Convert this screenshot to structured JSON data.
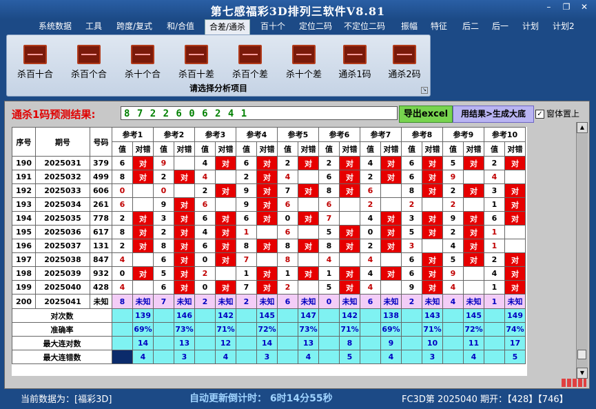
{
  "title": "第七感福彩3D排列三软件V8.81",
  "window_buttons": [
    "–",
    "❐",
    "✕"
  ],
  "menu": [
    "系统数据",
    "工具",
    "跨度/复式",
    "和/合值",
    "合差/通杀",
    "百十个",
    "定位二码",
    "不定位二码",
    "振幅",
    "特征",
    "后二",
    "后一",
    "计划",
    "计划2"
  ],
  "menu_active_index": 4,
  "ribbon": {
    "buttons": [
      "杀百十合",
      "杀百个合",
      "杀十个合",
      "杀百十差",
      "杀百个差",
      "杀十个差",
      "通杀1码",
      "通杀2码"
    ],
    "caption": "请选择分析项目"
  },
  "prediction": {
    "label": "通杀1码预测结果:",
    "value": "8 7 2 2 6 0 6 2 4 1",
    "export_button": "导出excel",
    "generate_button": "用结果>生成大底",
    "checkbox_label": "窗体置上",
    "checkbox_checked": true
  },
  "table": {
    "headers": {
      "seq": "序号",
      "period": "期号",
      "number": "号码",
      "value": "值",
      "result": "对错"
    },
    "refs": [
      "参考1",
      "参考2",
      "参考3",
      "参考4",
      "参考5",
      "参考6",
      "参考7",
      "参考8",
      "参考9",
      "参考10"
    ],
    "hit_text": "对",
    "rows": [
      {
        "seq": "190",
        "period": "2025031",
        "number": "379",
        "vals": [
          "6",
          "9",
          "4",
          "6",
          "2",
          "2",
          "4",
          "6",
          "5",
          "2"
        ],
        "hits": [
          1,
          0,
          1,
          1,
          1,
          1,
          1,
          1,
          1,
          1
        ],
        "red": [
          0,
          1,
          0,
          0,
          0,
          0,
          0,
          0,
          0,
          0
        ]
      },
      {
        "seq": "191",
        "period": "2025032",
        "number": "499",
        "vals": [
          "8",
          "2",
          "4",
          "2",
          "4",
          "6",
          "2",
          "6",
          "9",
          "4"
        ],
        "hits": [
          1,
          1,
          0,
          1,
          0,
          1,
          1,
          1,
          0,
          0
        ],
        "red": [
          0,
          0,
          1,
          0,
          1,
          0,
          0,
          0,
          1,
          1
        ]
      },
      {
        "seq": "192",
        "period": "2025033",
        "number": "606",
        "vals": [
          "0",
          "0",
          "2",
          "9",
          "7",
          "8",
          "6",
          "8",
          "2",
          "3"
        ],
        "hits": [
          0,
          0,
          1,
          1,
          1,
          1,
          0,
          1,
          1,
          1
        ],
        "red": [
          1,
          1,
          0,
          0,
          0,
          0,
          1,
          0,
          0,
          0
        ]
      },
      {
        "seq": "193",
        "period": "2025034",
        "number": "261",
        "vals": [
          "6",
          "9",
          "6",
          "9",
          "6",
          "6",
          "2",
          "2",
          "2",
          "1"
        ],
        "hits": [
          0,
          1,
          0,
          1,
          0,
          0,
          0,
          0,
          0,
          1
        ],
        "red": [
          1,
          0,
          1,
          0,
          1,
          1,
          1,
          1,
          1,
          0
        ]
      },
      {
        "seq": "194",
        "period": "2025035",
        "number": "778",
        "vals": [
          "2",
          "3",
          "6",
          "6",
          "0",
          "7",
          "4",
          "3",
          "9",
          "6"
        ],
        "hits": [
          1,
          1,
          1,
          1,
          1,
          0,
          1,
          1,
          1,
          1
        ],
        "red": [
          0,
          0,
          0,
          0,
          0,
          1,
          0,
          0,
          0,
          0
        ]
      },
      {
        "seq": "195",
        "period": "2025036",
        "number": "617",
        "vals": [
          "8",
          "2",
          "4",
          "1",
          "6",
          "5",
          "0",
          "5",
          "2",
          "1"
        ],
        "hits": [
          1,
          1,
          1,
          0,
          0,
          1,
          1,
          1,
          1,
          0
        ],
        "red": [
          0,
          0,
          0,
          1,
          1,
          0,
          0,
          0,
          0,
          1
        ]
      },
      {
        "seq": "196",
        "period": "2025037",
        "number": "131",
        "vals": [
          "2",
          "8",
          "6",
          "8",
          "8",
          "8",
          "2",
          "3",
          "4",
          "1"
        ],
        "hits": [
          1,
          1,
          1,
          1,
          1,
          1,
          1,
          0,
          1,
          0
        ],
        "red": [
          0,
          0,
          0,
          0,
          0,
          0,
          0,
          1,
          0,
          1
        ]
      },
      {
        "seq": "197",
        "period": "2025038",
        "number": "847",
        "vals": [
          "4",
          "6",
          "0",
          "7",
          "8",
          "4",
          "4",
          "6",
          "5",
          "2"
        ],
        "hits": [
          0,
          1,
          1,
          0,
          0,
          0,
          0,
          1,
          1,
          1
        ],
        "red": [
          1,
          0,
          0,
          1,
          1,
          1,
          1,
          0,
          0,
          0
        ]
      },
      {
        "seq": "198",
        "period": "2025039",
        "number": "932",
        "vals": [
          "0",
          "5",
          "2",
          "1",
          "1",
          "1",
          "4",
          "6",
          "9",
          "4"
        ],
        "hits": [
          1,
          1,
          0,
          1,
          1,
          1,
          1,
          1,
          0,
          1
        ],
        "red": [
          0,
          0,
          1,
          0,
          0,
          0,
          0,
          0,
          1,
          0
        ]
      },
      {
        "seq": "199",
        "period": "2025040",
        "number": "428",
        "vals": [
          "4",
          "6",
          "0",
          "7",
          "2",
          "5",
          "4",
          "9",
          "4",
          "1"
        ],
        "hits": [
          0,
          1,
          1,
          1,
          0,
          1,
          0,
          1,
          0,
          1
        ],
        "red": [
          1,
          0,
          0,
          0,
          1,
          0,
          1,
          0,
          1,
          0
        ]
      }
    ],
    "future_row": {
      "seq": "200",
      "period": "2025041",
      "number": "未知",
      "vals": [
        "8",
        "7",
        "2",
        "2",
        "6",
        "0",
        "6",
        "2",
        "4",
        "1"
      ],
      "result": "未知"
    },
    "stats": [
      {
        "label": "对次数",
        "values": [
          "139",
          "146",
          "142",
          "145",
          "147",
          "142",
          "138",
          "143",
          "145",
          "149"
        ]
      },
      {
        "label": "准确率",
        "values": [
          "69%",
          "73%",
          "71%",
          "72%",
          "73%",
          "71%",
          "69%",
          "71%",
          "72%",
          "74%"
        ]
      },
      {
        "label": "最大连对数",
        "values": [
          "14",
          "13",
          "12",
          "14",
          "13",
          "8",
          "9",
          "10",
          "11",
          "17"
        ]
      },
      {
        "label": "最大连错数",
        "values": [
          "4",
          "3",
          "4",
          "3",
          "4",
          "5",
          "4",
          "3",
          "4",
          "5"
        ]
      }
    ]
  },
  "status": {
    "current_data": "当前数据为：[福彩3D]",
    "countdown": "自动更新倒计时： 6时14分55秒",
    "draw_info": "FC3D第 2025040 期开：【428】【746】"
  },
  "colors": {
    "hit": "#e60000",
    "future": "#f3cdf7",
    "stats": "#7ff2f2",
    "background": "#1c4a86"
  }
}
